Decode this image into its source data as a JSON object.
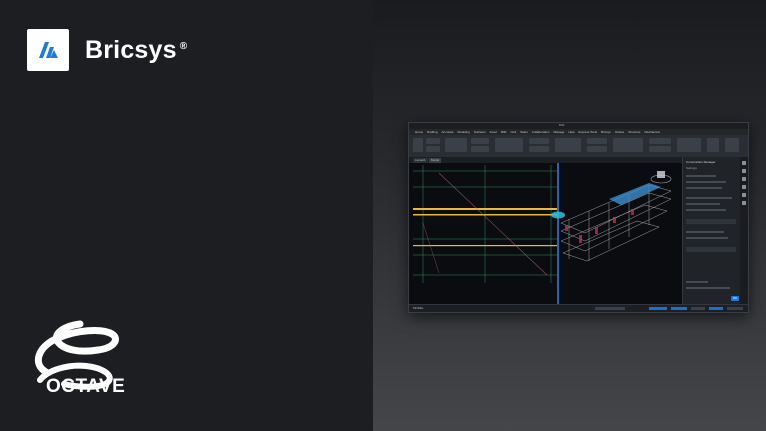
{
  "brand": {
    "name": "Bricsys",
    "registered": "®"
  },
  "partner": {
    "name": "OCTAVE"
  },
  "screenshot": {
    "window_title": "BIM",
    "menu": [
      "Home",
      "Drafting",
      "Annotate",
      "Modeling",
      "Surfaces",
      "Insert",
      "BIM",
      "Civil",
      "Stairs",
      "Collaboration",
      "Manage",
      "Help",
      "Express Tools",
      "Bricsys",
      "Octave",
      "Structure",
      "Mechanical",
      "Point Cloud",
      "Sheet Metal"
    ],
    "doc_tab": "Layout1",
    "doc_tab_active": "Model",
    "side_panel": {
      "title": "Construction Manager",
      "subtitle": "Settings",
      "ok_label": "OK"
    },
    "status": {
      "model_label": "MODEL"
    },
    "colors": {
      "accent": "#1f7ae0",
      "beam": "#e8b93a",
      "grid": "#3fae6a",
      "section_line": "#2b8cff"
    }
  }
}
